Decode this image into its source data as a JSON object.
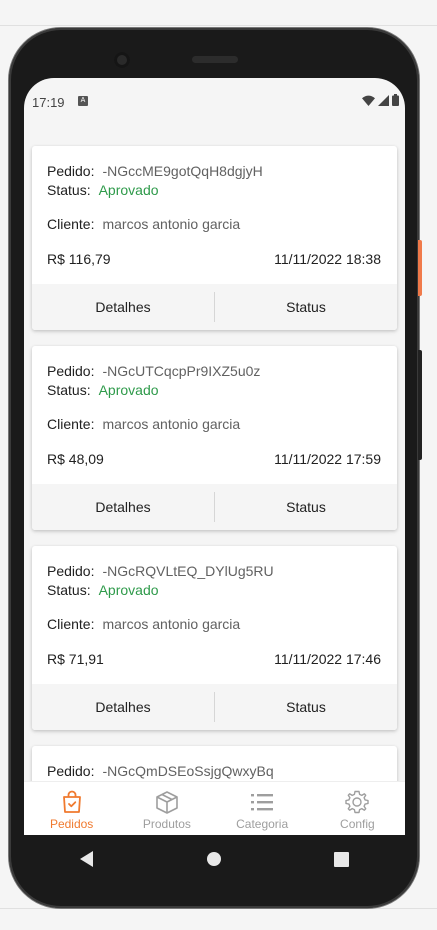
{
  "orders": [
    {
      "pedido_label": "Pedido:",
      "pedido_id": "-NGccME9gotQqH8dgjyH",
      "status_label": "Status:",
      "status_value": "Aprovado",
      "cliente_label": "Cliente:",
      "cliente_name": "marcos antonio garcia",
      "price": "R$ 116,79",
      "date": "11/11/2022 18:38",
      "details_label": "Detalhes",
      "status_button": "Status"
    },
    {
      "pedido_label": "Pedido:",
      "pedido_id": "-NGcUTCqcpPr9IXZ5u0z",
      "status_label": "Status:",
      "status_value": "Aprovado",
      "cliente_label": "Cliente:",
      "cliente_name": "marcos antonio garcia",
      "price": "R$ 48,09",
      "date": "11/11/2022 17:59",
      "details_label": "Detalhes",
      "status_button": "Status"
    },
    {
      "pedido_label": "Pedido:",
      "pedido_id": "-NGcRQVLtEQ_DYlUg5RU",
      "status_label": "Status:",
      "status_value": "Aprovado",
      "cliente_label": "Cliente:",
      "cliente_name": "marcos antonio garcia",
      "price": "R$ 71,91",
      "date": "11/11/2022 17:46",
      "details_label": "Detalhes",
      "status_button": "Status"
    },
    {
      "pedido_label": "Pedido:",
      "pedido_id": "-NGcQmDSEoSsjgQwxyBq"
    }
  ],
  "statusbar": {
    "time": "17:19",
    "notification_icon": "A"
  },
  "nav": [
    {
      "label": "Pedidos",
      "icon": "shopping-bag-icon",
      "active": true
    },
    {
      "label": "Produtos",
      "icon": "box-icon",
      "active": false
    },
    {
      "label": "Categoria",
      "icon": "list-icon",
      "active": false
    },
    {
      "label": "Config",
      "icon": "gear-icon",
      "active": false
    }
  ],
  "colors": {
    "accent": "#f07a2f",
    "approved": "#2e9a4a",
    "background": "#f5f5f5"
  }
}
